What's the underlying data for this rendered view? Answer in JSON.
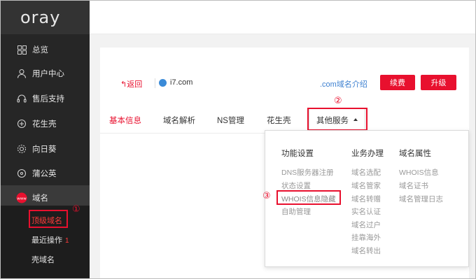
{
  "logo": "oray",
  "sidebar": {
    "items": [
      {
        "label": "总览",
        "icon": "grid-icon"
      },
      {
        "label": "用户中心",
        "icon": "user-icon"
      },
      {
        "label": "售后支持",
        "icon": "headset-icon"
      },
      {
        "label": "花生壳",
        "icon": "peanut-icon"
      },
      {
        "label": "向日葵",
        "icon": "sunflower-icon"
      },
      {
        "label": "蒲公英",
        "icon": "dandelion-icon"
      },
      {
        "label": "域名",
        "icon": "www-icon"
      }
    ],
    "sub_items": [
      {
        "label": "顶级域名"
      },
      {
        "label": "最近操作",
        "badge": "1"
      },
      {
        "label": "壳域名"
      }
    ]
  },
  "annotations": {
    "one": "①",
    "two": "②",
    "three": "③"
  },
  "info": {
    "back": "返回",
    "domain": "i7.com",
    "intro": ".com域名介绍",
    "renew": "续费",
    "upgrade": "升级"
  },
  "tabs": [
    "基本信息",
    "域名解析",
    "NS管理",
    "花生壳",
    "其他服务"
  ],
  "dropdown": {
    "columns": [
      {
        "title": "功能设置",
        "items": [
          "DNS服务器注册",
          "状态设置",
          "WHOIS信息隐藏",
          "自助管理"
        ]
      },
      {
        "title": "业务办理",
        "items": [
          "域名选配",
          "域名管家",
          "域名转赠",
          "实名认证",
          "域名过户",
          "挂靠海外",
          "域名转出"
        ]
      },
      {
        "title": "域名属性",
        "items": [
          "WHOIS信息",
          "域名证书",
          "域名管理日志"
        ]
      }
    ]
  },
  "colors": {
    "accent": "#e8102e",
    "sidebar": "#262626",
    "link": "#3b7fd0"
  }
}
